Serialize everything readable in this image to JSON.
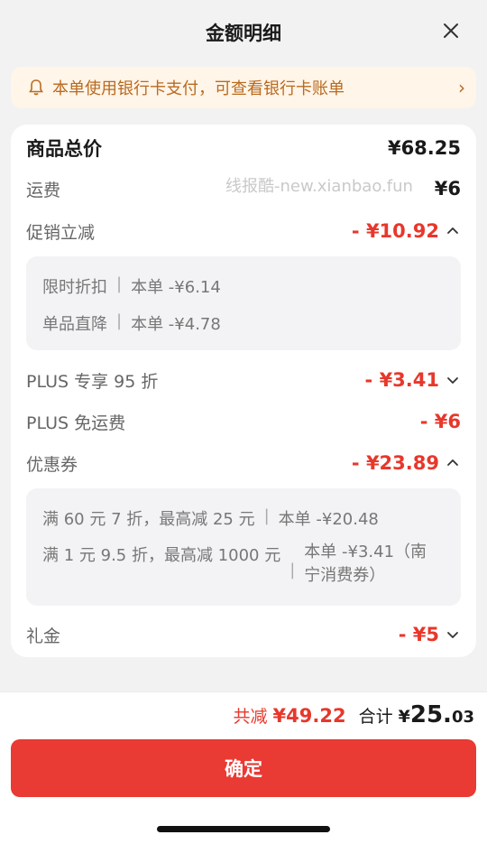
{
  "header": {
    "title": "金额明细"
  },
  "notice": {
    "text": "本单使用银行卡支付，可查看银行卡账单",
    "chevron": "›"
  },
  "watermark": "线报酷-new.xianbao.fun",
  "rows": {
    "total": {
      "label": "商品总价",
      "value": "¥68.25"
    },
    "shipping": {
      "label": "运费",
      "value": "¥6"
    },
    "promo": {
      "label": "促销立减",
      "value": "- ¥10.92"
    },
    "plus95": {
      "label": "PLUS 专享 95 折",
      "value": "- ¥3.41"
    },
    "plusShip": {
      "label": "PLUS 免运费",
      "value": "- ¥6"
    },
    "coupon": {
      "label": "优惠券",
      "value": "- ¥23.89"
    },
    "gift": {
      "label": "礼金",
      "value": "- ¥5"
    }
  },
  "promo_details": [
    {
      "name": "限时折扣",
      "sep": "|",
      "value": "本单 -¥6.14"
    },
    {
      "name": "单品直降",
      "sep": "|",
      "value": "本单 -¥4.78"
    }
  ],
  "coupon_details": [
    {
      "name": "满 60 元 7 折，最高减 25 元",
      "sep": "|",
      "value": "本单 -¥20.48"
    },
    {
      "name": "满 1 元 9.5 折，最高减 1000 元",
      "sep": "|",
      "value_line1": "本单 -¥3.41（南",
      "value_line2": "宁消费券）"
    }
  ],
  "summary": {
    "reduce_label": "共减",
    "reduce_value": "¥49.22",
    "total_label": "合计",
    "total_currency": "¥",
    "total_int": "25.",
    "total_dec": "03"
  },
  "confirm_label": "确定"
}
